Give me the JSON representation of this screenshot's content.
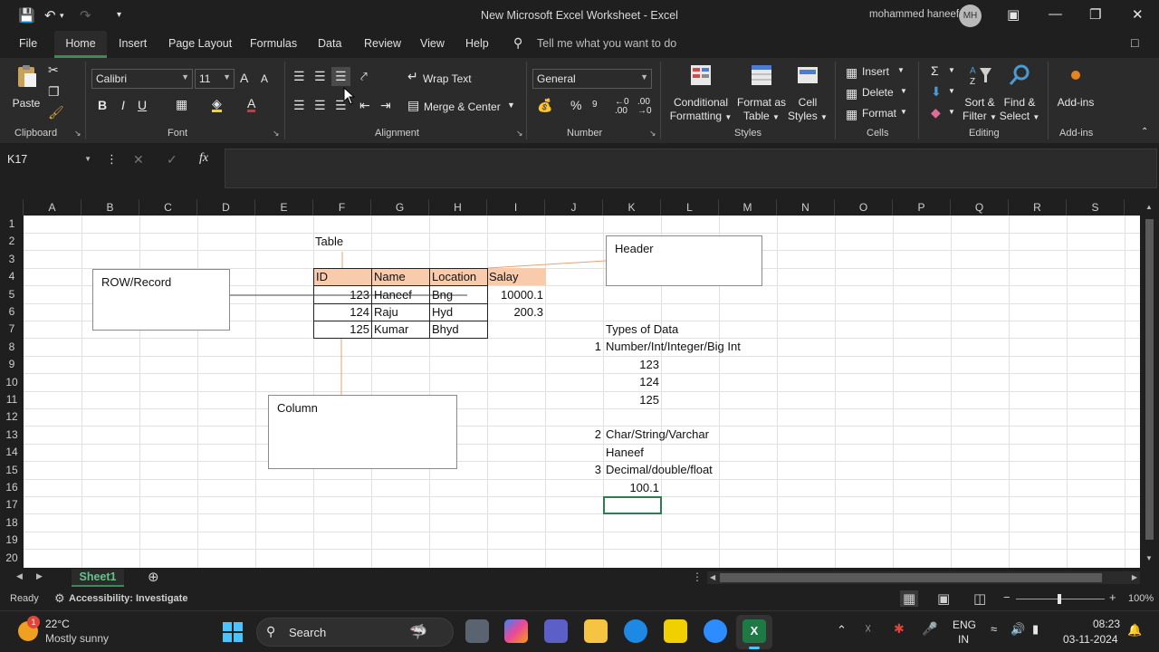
{
  "titlebar": {
    "doc_title": "New Microsoft Excel Worksheet  -  Excel",
    "user_name": "mohammed haneef",
    "avatar_initials": "MH"
  },
  "menu": {
    "tabs": [
      "File",
      "Home",
      "Insert",
      "Page Layout",
      "Formulas",
      "Data",
      "Review",
      "View",
      "Help"
    ],
    "tell_me": "Tell me what you want to do"
  },
  "ribbon": {
    "clipboard": {
      "label": "Clipboard",
      "paste": "Paste"
    },
    "font": {
      "label": "Font",
      "family": "Calibri",
      "size": "11"
    },
    "alignment": {
      "label": "Alignment",
      "wrap": "Wrap Text",
      "merge": "Merge & Center"
    },
    "number": {
      "label": "Number",
      "format": "General"
    },
    "styles": {
      "label": "Styles",
      "cond_1": "Conditional",
      "cond_2": "Formatting",
      "fmt_1": "Format as",
      "fmt_2": "Table",
      "cell_1": "Cell",
      "cell_2": "Styles"
    },
    "cells": {
      "label": "Cells",
      "insert": "Insert",
      "delete": "Delete",
      "format": "Format"
    },
    "editing": {
      "label": "Editing",
      "sort_1": "Sort &",
      "sort_2": "Filter",
      "find_1": "Find &",
      "find_2": "Select"
    },
    "addins": {
      "label": "Add-ins",
      "button": "Add-ins"
    }
  },
  "formula_bar": {
    "name_box": "K17",
    "fx": "fx",
    "content": ""
  },
  "columns": [
    "A",
    "B",
    "C",
    "D",
    "E",
    "F",
    "G",
    "H",
    "I",
    "J",
    "K",
    "L",
    "M",
    "N",
    "O",
    "P",
    "Q",
    "R",
    "S"
  ],
  "rows": [
    "1",
    "2",
    "3",
    "4",
    "5",
    "6",
    "7",
    "8",
    "9",
    "10",
    "11",
    "12",
    "13",
    "14",
    "15",
    "16",
    "17",
    "18",
    "19",
    "20"
  ],
  "cells": {
    "f2": "Table",
    "f4": "ID",
    "g4": "Name",
    "h4": "Location",
    "i4": "Salay",
    "f5": "123",
    "g5": "Haneef",
    "h5": "Bng",
    "i5": "10000.1",
    "f6": "124",
    "g6": "Raju",
    "h6": "Hyd",
    "i6": "200.3",
    "f7": "125",
    "g7": "Kumar",
    "h7": "Bhyd",
    "k7": "Types of Data",
    "j8": "1",
    "k8": "Number/Int/Integer/Big Int",
    "k9": "123",
    "k10": "124",
    "k11": "125",
    "j13": "2",
    "k13": "Char/String/Varchar",
    "k14": "Haneef",
    "j15": "3",
    "k15": "Decimal/double/float",
    "k16": "100.1"
  },
  "shapes": {
    "row": "ROW/Record",
    "header": "Header",
    "column": "Column"
  },
  "sheet_tab": "Sheet1",
  "status": {
    "ready": "Ready",
    "accessibility": "Accessibility: Investigate",
    "zoom": "100%"
  },
  "taskbar": {
    "temp": "22°C",
    "weather": "Mostly sunny",
    "weather_badge": "1",
    "search": "Search",
    "lang_1": "ENG",
    "lang_2": "IN",
    "time": "08:23",
    "date": "03-11-2024"
  },
  "colors": {
    "accent": "#3b8b5a",
    "header_fill": "#f8cbad",
    "connector": "#e8a070"
  }
}
